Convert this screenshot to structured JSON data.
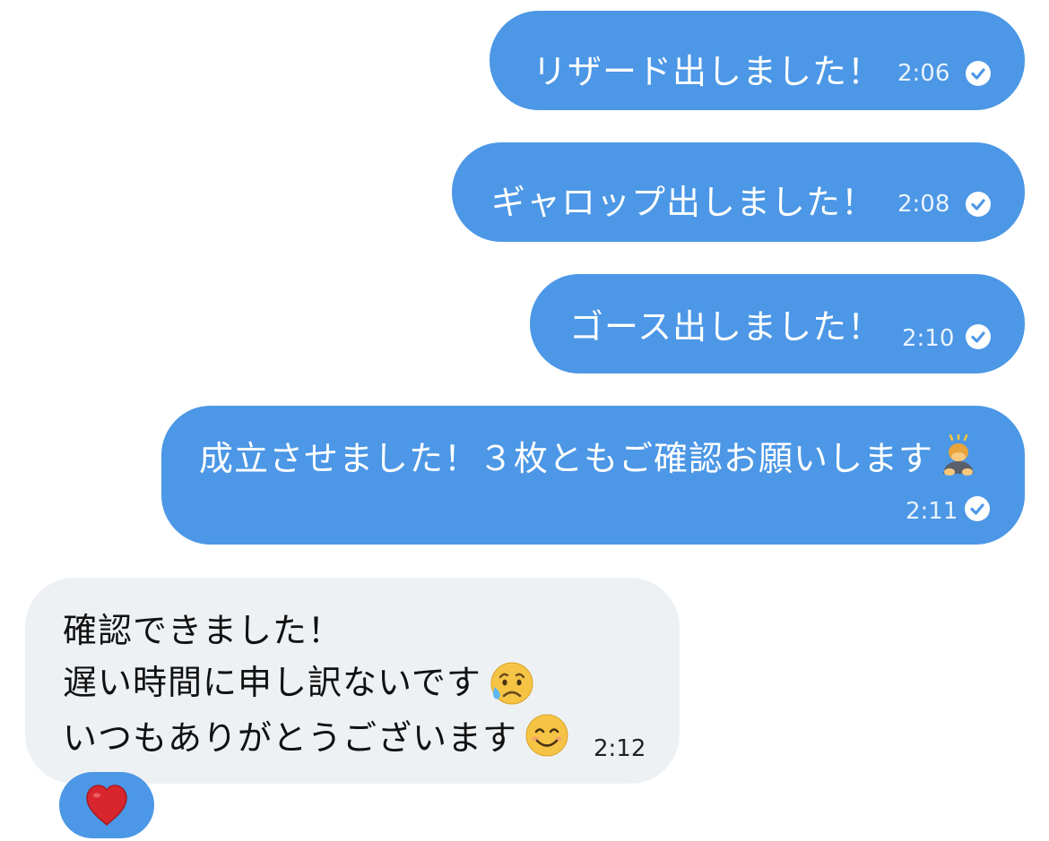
{
  "messages": {
    "m1": {
      "text": "リザード出しました！",
      "time": "2:06",
      "status_icon": "read-check-icon"
    },
    "m2": {
      "text": "ギャロップ出しました！",
      "time": "2:08",
      "status_icon": "read-check-icon"
    },
    "m3": {
      "text": "ゴース出しました！",
      "time": "2:10",
      "status_icon": "read-check-icon"
    },
    "m4": {
      "text": "成立させました！３枚ともご確認お願いします",
      "emoji": "person-bowing-emoji",
      "time": "2:11",
      "status_icon": "read-check-icon"
    },
    "m5": {
      "line1": "確認できました！",
      "line2": "遅い時間に申し訳ないです",
      "line2_emoji": "sad-sweat-face-emoji",
      "line3": "いつもありがとうございます",
      "line3_emoji": "smiling-face-emoji",
      "time": "2:12"
    }
  },
  "reaction": {
    "emoji": "red-heart-emoji"
  },
  "colors": {
    "outgoing_bubble": "#4c97e6",
    "incoming_bubble": "#eef1f4",
    "outgoing_text": "#ffffff",
    "incoming_text": "#111111"
  }
}
